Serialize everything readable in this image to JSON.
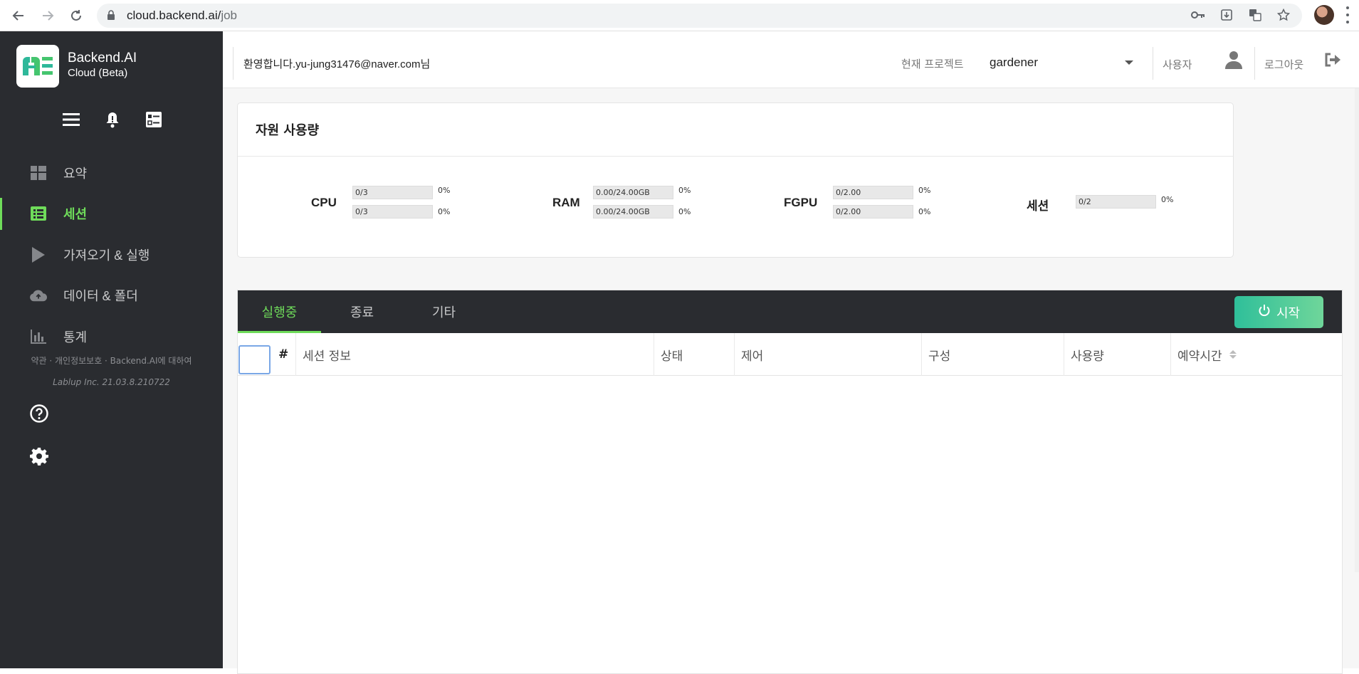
{
  "browser": {
    "url_host": "cloud.backend.ai/",
    "url_path": "job"
  },
  "brand": {
    "name": "Backend.AI",
    "subtitle": "Cloud (Beta)",
    "accent_color": "#6fdc5a"
  },
  "sidebar": {
    "items": [
      {
        "label": "요약",
        "icon": "dashboard-icon",
        "active": false
      },
      {
        "label": "세션",
        "icon": "list-icon",
        "active": true
      },
      {
        "label": "가져오기 & 실행",
        "icon": "play-icon",
        "active": false
      },
      {
        "label": "데이터 & 폴더",
        "icon": "cloud-upload-icon",
        "active": false
      },
      {
        "label": "통계",
        "icon": "bar-chart-icon",
        "active": false
      }
    ],
    "footer_links": "약관 · 개인정보보호 · Backend.AI에 대하여",
    "version": "Lablup Inc. 21.03.8.210722"
  },
  "header": {
    "welcome": "환영합니다.yu-jung31476@naver.com님",
    "project_label": "현재 프로젝트",
    "project_value": "gardener",
    "user_label": "사용자",
    "logout_label": "로그아웃"
  },
  "resources": {
    "title": "자원 사용량",
    "groups": [
      {
        "name": "CPU",
        "bars": [
          {
            "text": "0/3",
            "pct": "0%"
          },
          {
            "text": "0/3",
            "pct": "0%"
          }
        ]
      },
      {
        "name": "RAM",
        "bars": [
          {
            "text": "0.00/24.00GB",
            "pct": "0%"
          },
          {
            "text": "0.00/24.00GB",
            "pct": "0%"
          }
        ]
      },
      {
        "name": "FGPU",
        "bars": [
          {
            "text": "0/2.00",
            "pct": "0%"
          },
          {
            "text": "0/2.00",
            "pct": "0%"
          }
        ]
      },
      {
        "name": "세션",
        "bars": [
          {
            "text": "0/2",
            "pct": "0%"
          }
        ]
      }
    ]
  },
  "sessions": {
    "tabs": [
      {
        "label": "실행중",
        "active": true
      },
      {
        "label": "종료",
        "active": false
      },
      {
        "label": "기타",
        "active": false
      }
    ],
    "start_label": "시작",
    "columns": [
      "#",
      "세션 정보",
      "상태",
      "제어",
      "구성",
      "사용량",
      "예약시간"
    ]
  }
}
